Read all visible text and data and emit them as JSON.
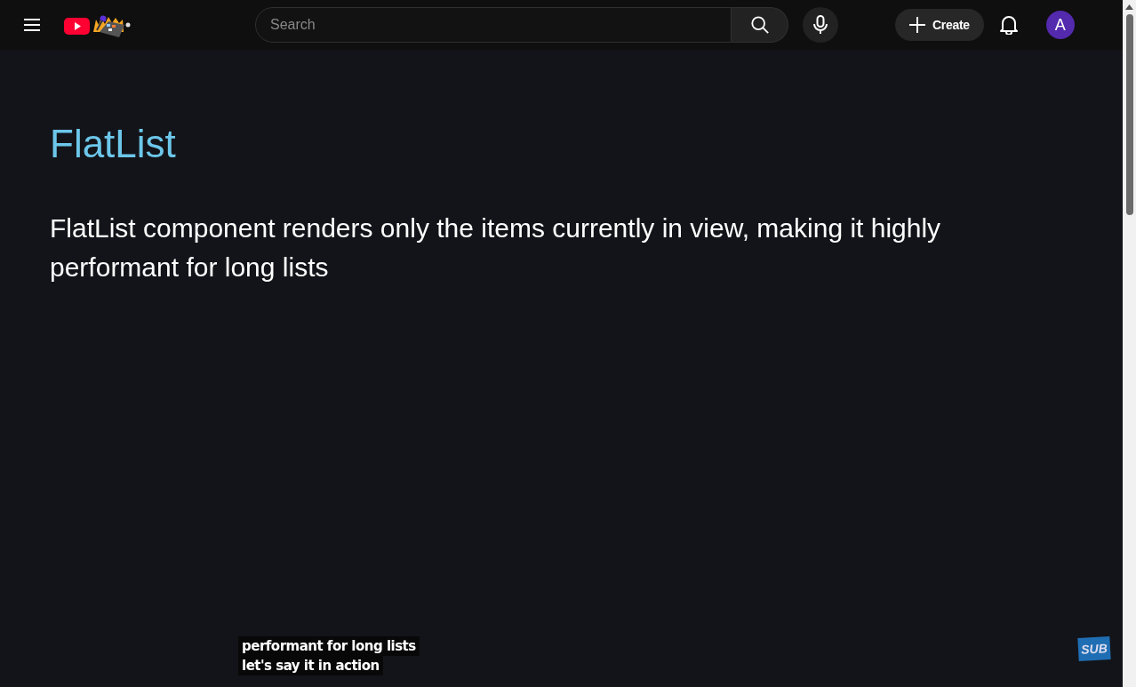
{
  "header": {
    "search": {
      "placeholder": "Search"
    },
    "create_button": "Create",
    "avatar": "A"
  },
  "slide": {
    "title": "FlatList",
    "body": "FlatList component renders only the items currently in view, making it highly performant for long lists"
  },
  "captions": [
    "performant for long lists",
    "let's say it in action"
  ],
  "subscribe_badge": "SUB"
}
